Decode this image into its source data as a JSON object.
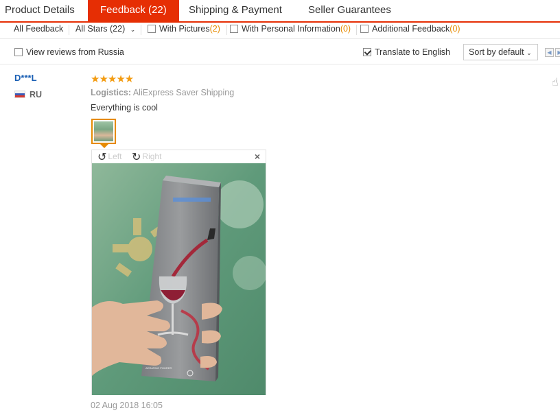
{
  "tabs": [
    {
      "label": "Product Details"
    },
    {
      "label": "Feedback (22)",
      "active": true
    },
    {
      "label": "Shipping & Payment"
    },
    {
      "label": "Seller Guarantees"
    }
  ],
  "filters": {
    "all_feedback": "All Feedback",
    "all_stars": "All Stars (22)",
    "with_pictures_label": "With Pictures",
    "with_pictures_count": "(2)",
    "personal_info_label": "With Personal Information",
    "personal_info_count": "(0)",
    "additional_label": "Additional Feedback",
    "additional_count": "(0)"
  },
  "toolbar": {
    "view_russia": "View reviews from Russia",
    "translate": "Translate to English",
    "translate_checked": true,
    "sort": "Sort by default"
  },
  "review": {
    "user": "D***L",
    "country": "RU",
    "rating": 5,
    "stars": "★★★★★",
    "logistics_label": "Logistics:",
    "logistics_value": "AliExpress Saver Shipping",
    "text": "Everything is cool",
    "date": "02 Aug 2018 16:05"
  },
  "viewer": {
    "rotate_left": "Left",
    "rotate_right": "Right",
    "close": "×"
  },
  "photo": {
    "box_label": "AERATING POURER"
  },
  "colors": {
    "accent": "#e62e04",
    "star": "#f39c12",
    "count": "#e68a00",
    "link": "#1a5fb4"
  },
  "icons": {
    "rotate_left": "rotate-left-icon",
    "rotate_right": "rotate-right-icon",
    "close": "close-icon",
    "like": "thumbs-up-icon",
    "flag": "russia-flag-icon"
  }
}
